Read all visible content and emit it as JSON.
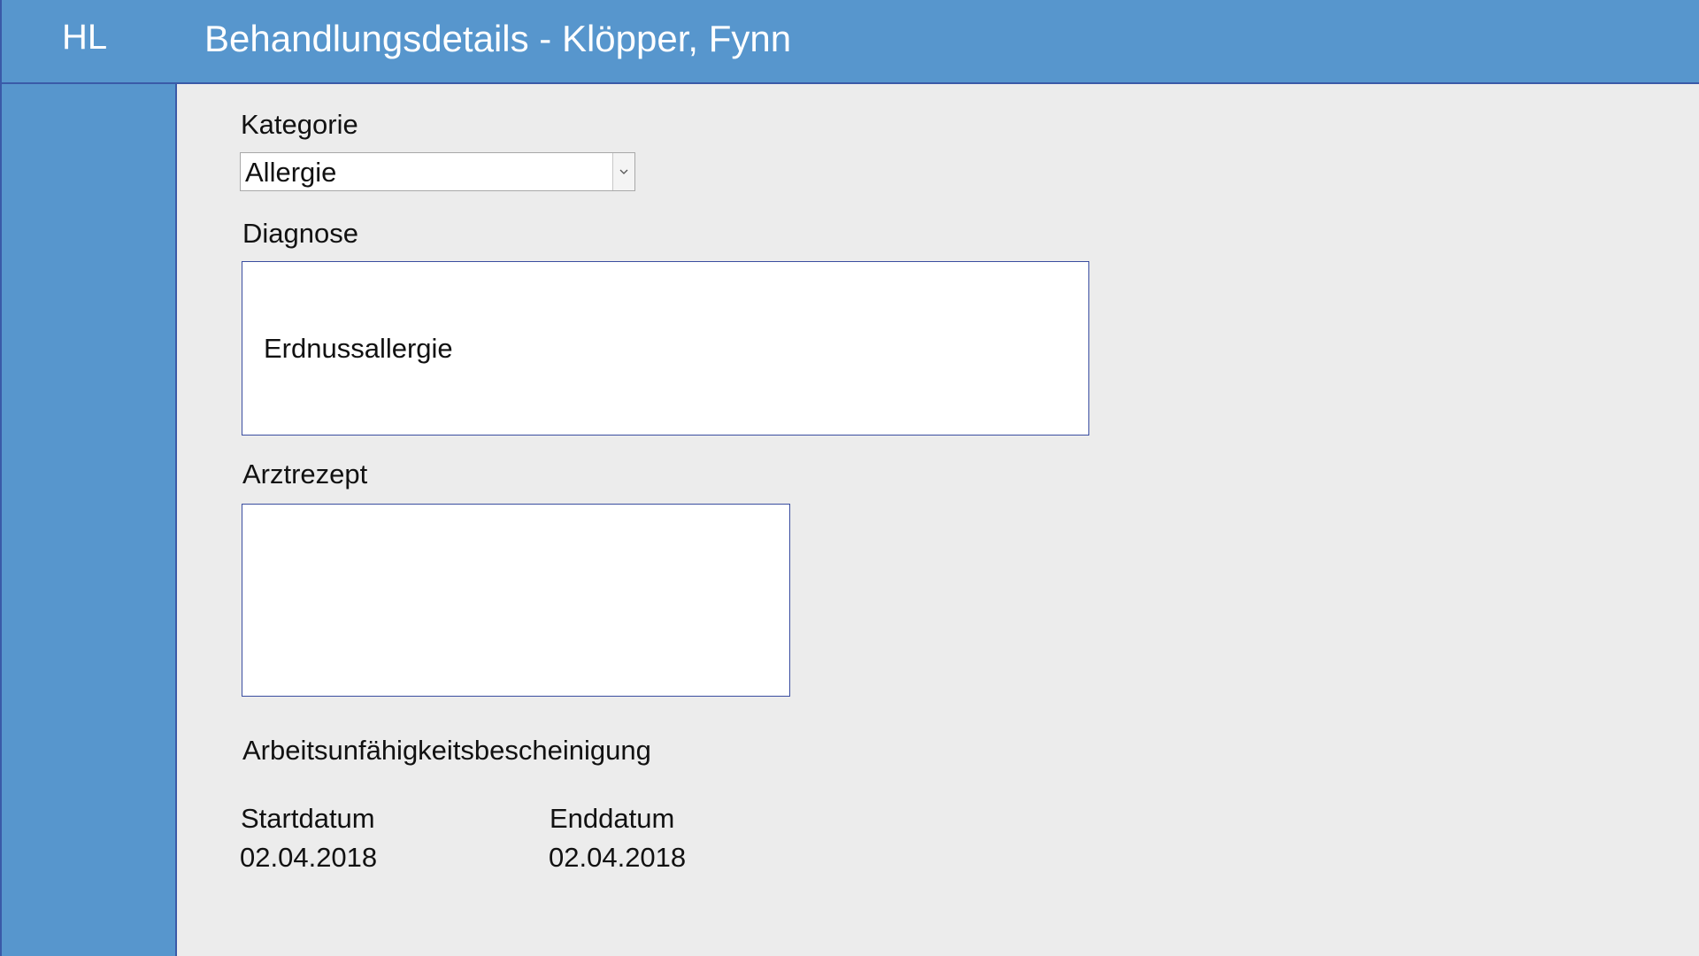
{
  "header": {
    "logo": "HL",
    "title": "Behandlungsdetails - Klöpper, Fynn"
  },
  "form": {
    "kategorie_label": "Kategorie",
    "kategorie_value": "Allergie",
    "diagnose_label": "Diagnose",
    "diagnose_value": "Erdnussallergie",
    "arztrezept_label": "Arztrezept",
    "arztrezept_value": "",
    "au_label": "Arbeitsunfähigkeitsbescheinigung",
    "startdatum_label": "Startdatum",
    "startdatum_value": "02.04.2018",
    "enddatum_label": "Enddatum",
    "enddatum_value": "02.04.2018"
  },
  "icons": {
    "dropdown": "chevron-down-icon"
  },
  "colors": {
    "header_bg": "#5796cd",
    "sidebar_bg": "#5796cd",
    "content_bg": "#ececec",
    "border_accent": "#3a4ea0"
  }
}
